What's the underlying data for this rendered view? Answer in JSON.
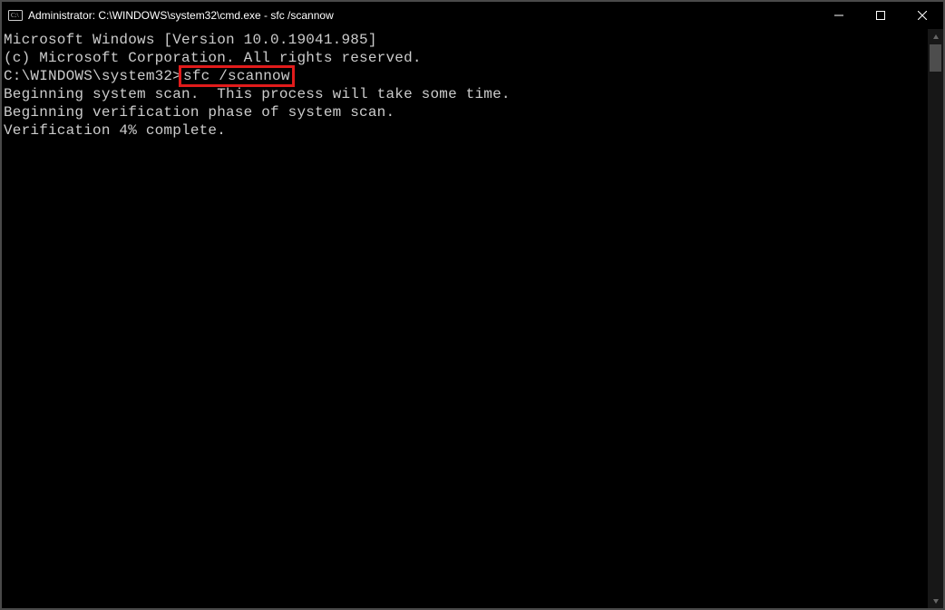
{
  "titlebar": {
    "title": "Administrator: C:\\WINDOWS\\system32\\cmd.exe - sfc  /scannow"
  },
  "terminal": {
    "line1": "Microsoft Windows [Version 10.0.19041.985]",
    "line2": "(c) Microsoft Corporation. All rights reserved.",
    "blank1": "",
    "prompt": "C:\\WINDOWS\\system32>",
    "command": "sfc /scannow",
    "blank2": "",
    "line3": "Beginning system scan.  This process will take some time.",
    "blank3": "",
    "line4": "Beginning verification phase of system scan.",
    "line5": "Verification 4% complete."
  }
}
